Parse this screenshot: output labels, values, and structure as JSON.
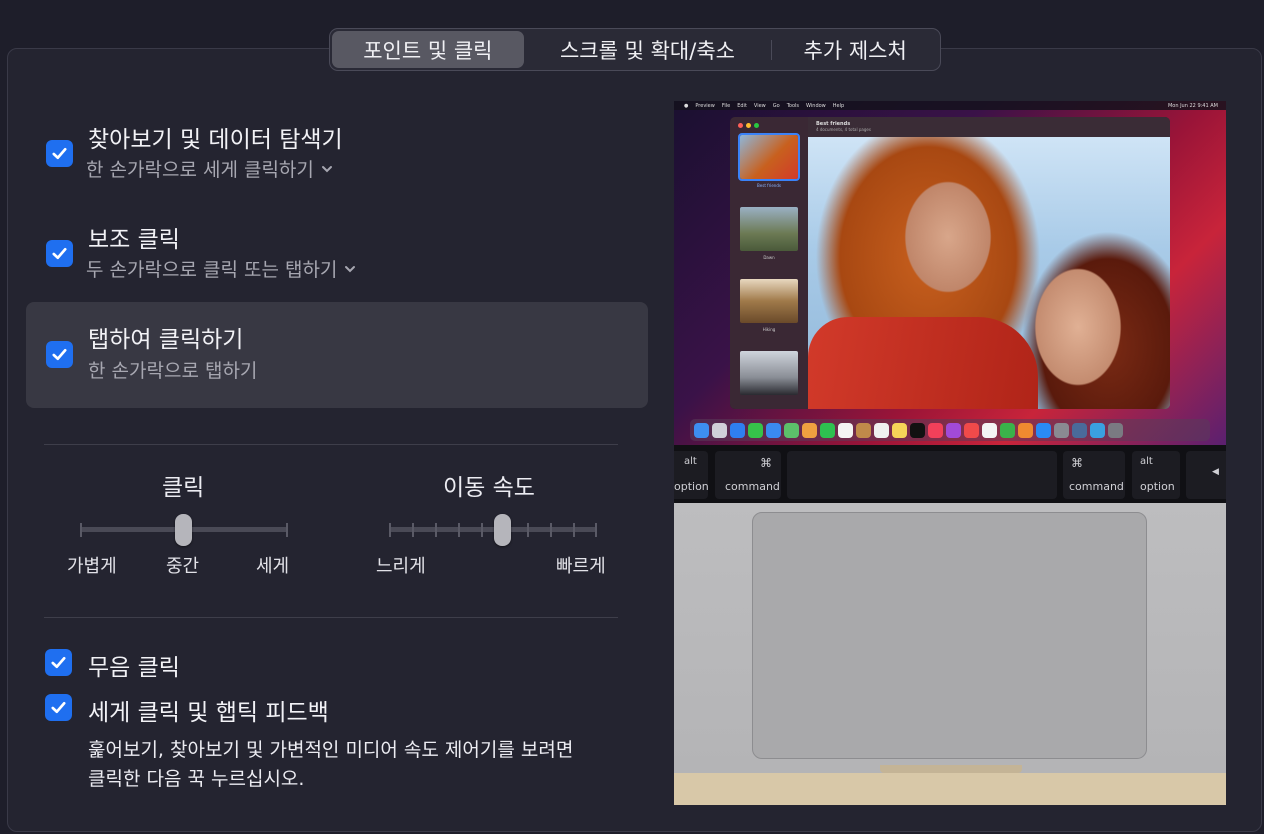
{
  "tabs": [
    {
      "label": "포인트 및 클릭",
      "active": true
    },
    {
      "label": "스크롤 및 확대/축소",
      "active": false
    },
    {
      "label": "추가 제스처",
      "active": false
    }
  ],
  "options": {
    "lookup": {
      "label": "찾아보기 및 데이터 탐색기",
      "sub": "한 손가락으로 세게 클릭하기",
      "checked": true
    },
    "secondary": {
      "label": "보조 클릭",
      "sub": "두 손가락으로 클릭 또는 탭하기",
      "checked": true
    },
    "tap": {
      "label": "탭하여 클릭하기",
      "sub": "한 손가락으로 탭하기",
      "checked": true
    }
  },
  "sliders": {
    "click": {
      "title": "클릭",
      "labels": [
        "가볍게",
        "중간",
        "세게"
      ],
      "value_index": 1,
      "steps": 3
    },
    "speed": {
      "title": "이동 속도",
      "min_label": "느리게",
      "max_label": "빠르게",
      "value_index": 5,
      "steps": 10
    }
  },
  "bottom": {
    "silent": {
      "label": "무음 클릭",
      "checked": true
    },
    "force": {
      "label": "세게 클릭 및 햅틱 피드백",
      "checked": true
    },
    "note_line1": "훑어보기, 찾아보기 및 가변적인 미디어 속도 제어기를 보려면",
    "note_line2": "클릭한 다음 꾹 누르십시오."
  },
  "preview": {
    "menubar": [
      "Preview",
      "File",
      "Edit",
      "View",
      "Go",
      "Tools",
      "Window",
      "Help"
    ],
    "clock": "Mon Jun 22  9:41 AM",
    "window_title": "Best friends",
    "window_subtitle": "4 documents, 4 total pages",
    "thumbs": [
      "Best friends",
      "Dawn",
      "Hiking",
      ""
    ],
    "keys": {
      "alt": "alt",
      "option": "option",
      "cmd_symbol": "⌘",
      "command": "command"
    }
  },
  "colors": {
    "accent": "#1f6ff0",
    "background": "#242430"
  }
}
